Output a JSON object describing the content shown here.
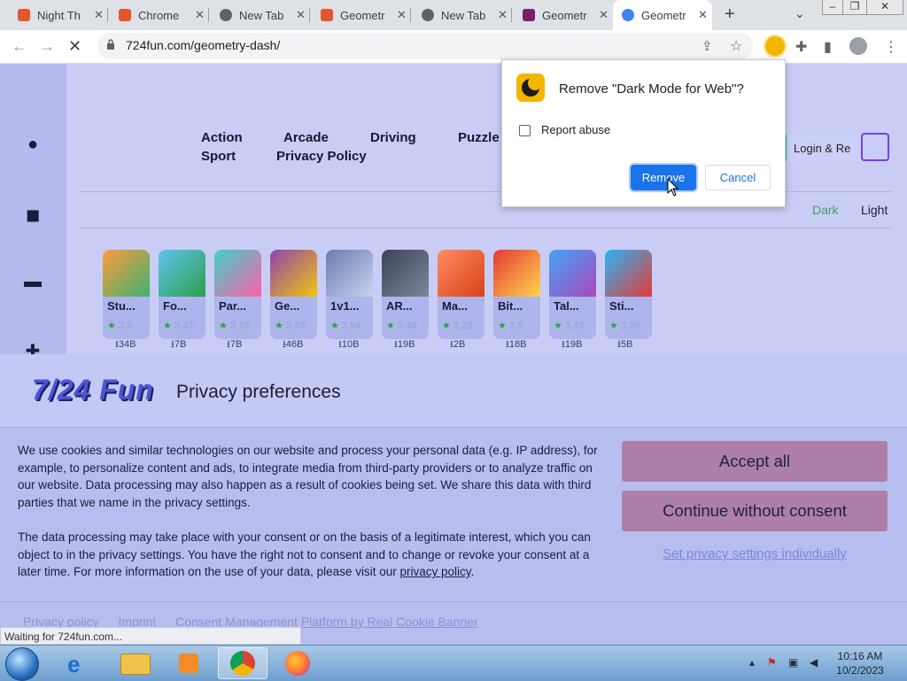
{
  "browser": {
    "tabs": [
      {
        "title": "Night Th",
        "color": "#e4572e"
      },
      {
        "title": "Chrome",
        "color": "#e4572e"
      },
      {
        "title": "New Tab",
        "color": "#5f6368"
      },
      {
        "title": "Geometr",
        "color": "#e4572e"
      },
      {
        "title": "New Tab",
        "color": "#5f6368"
      },
      {
        "title": "Geometr",
        "color": "#7b1f6b"
      },
      {
        "title": "Geometr",
        "color": "#4285f4"
      }
    ],
    "new_tab_symbol": "+",
    "url": "724fun.com/geometry-dash/"
  },
  "page": {
    "nav": [
      "Action",
      "Arcade",
      "Driving",
      "Puzzle",
      "Sport",
      "Privacy Policy"
    ],
    "login_label": "Login & Re",
    "theme": {
      "dark": "Dark",
      "light": "Light",
      "dark_color": "#3aa55d"
    },
    "games": [
      {
        "name": "Stu...",
        "rating": "3.5",
        "downloads": "34B",
        "colors": [
          "#ff9a3c",
          "#3cb371"
        ]
      },
      {
        "name": "Fo...",
        "rating": "3.42",
        "downloads": "7B",
        "colors": [
          "#5ec4f2",
          "#2d9e48"
        ]
      },
      {
        "name": "Par...",
        "rating": "3.78",
        "downloads": "7B",
        "colors": [
          "#3fd1c9",
          "#ff5fa8"
        ]
      },
      {
        "name": "Ge...",
        "rating": "3.49",
        "downloads": "46B",
        "colors": [
          "#8e44ad",
          "#f1c40f"
        ]
      },
      {
        "name": "1v1...",
        "rating": "3.54",
        "downloads": "10B",
        "colors": [
          "#6a7bb0",
          "#c8d3ef"
        ]
      },
      {
        "name": "AR...",
        "rating": "3.48",
        "downloads": "19B",
        "colors": [
          "#3b4456",
          "#7d8799"
        ]
      },
      {
        "name": "Ma...",
        "rating": "3.23",
        "downloads": "2B",
        "colors": [
          "#ff8a65",
          "#d84315"
        ]
      },
      {
        "name": "Bit...",
        "rating": "3.5",
        "downloads": "18B",
        "colors": [
          "#e53935",
          "#ffd54f"
        ]
      },
      {
        "name": "Tal...",
        "rating": "3.43",
        "downloads": "19B",
        "colors": [
          "#42a5f5",
          "#ab47bc"
        ]
      },
      {
        "name": "Sti...",
        "rating": "3.39",
        "downloads": "5B",
        "colors": [
          "#29b6f6",
          "#e53935"
        ]
      }
    ]
  },
  "dialog": {
    "title": "Remove \"Dark Mode for Web\"?",
    "report_label": "Report abuse",
    "remove_label": "Remove",
    "cancel_label": "Cancel"
  },
  "cookie_banner": {
    "logo_text": "7/24 Fun",
    "title": "Privacy preferences",
    "paragraph1": "We use cookies and similar technologies on our website and process your personal data (e.g. IP address), for example, to personalize content and ads, to integrate media from third-party providers or to analyze traffic on our website. Data processing may also happen as a result of cookies being set. We share this data with third parties that we name in the privacy settings.",
    "paragraph2_text": "The data processing may take place with your consent or on the basis of a legitimate interest, which you can object to in the privacy settings. You have the right not to consent and to change or revoke your consent at a later time. For more information on the use of your data, please visit our ",
    "paragraph2_link": "privacy policy",
    "paragraph2_end": ".",
    "accept_label": "Accept all",
    "continue_label": "Continue without consent",
    "settings_link": "Set privacy settings individually",
    "footer_links": [
      "Privacy policy",
      "Imprint",
      "Consent Management Platform by Real Cookie Banner"
    ]
  },
  "status_text": "Waiting for 724fun.com...",
  "taskbar": {
    "time": "10:16 AM",
    "date": "10/2/2023"
  }
}
